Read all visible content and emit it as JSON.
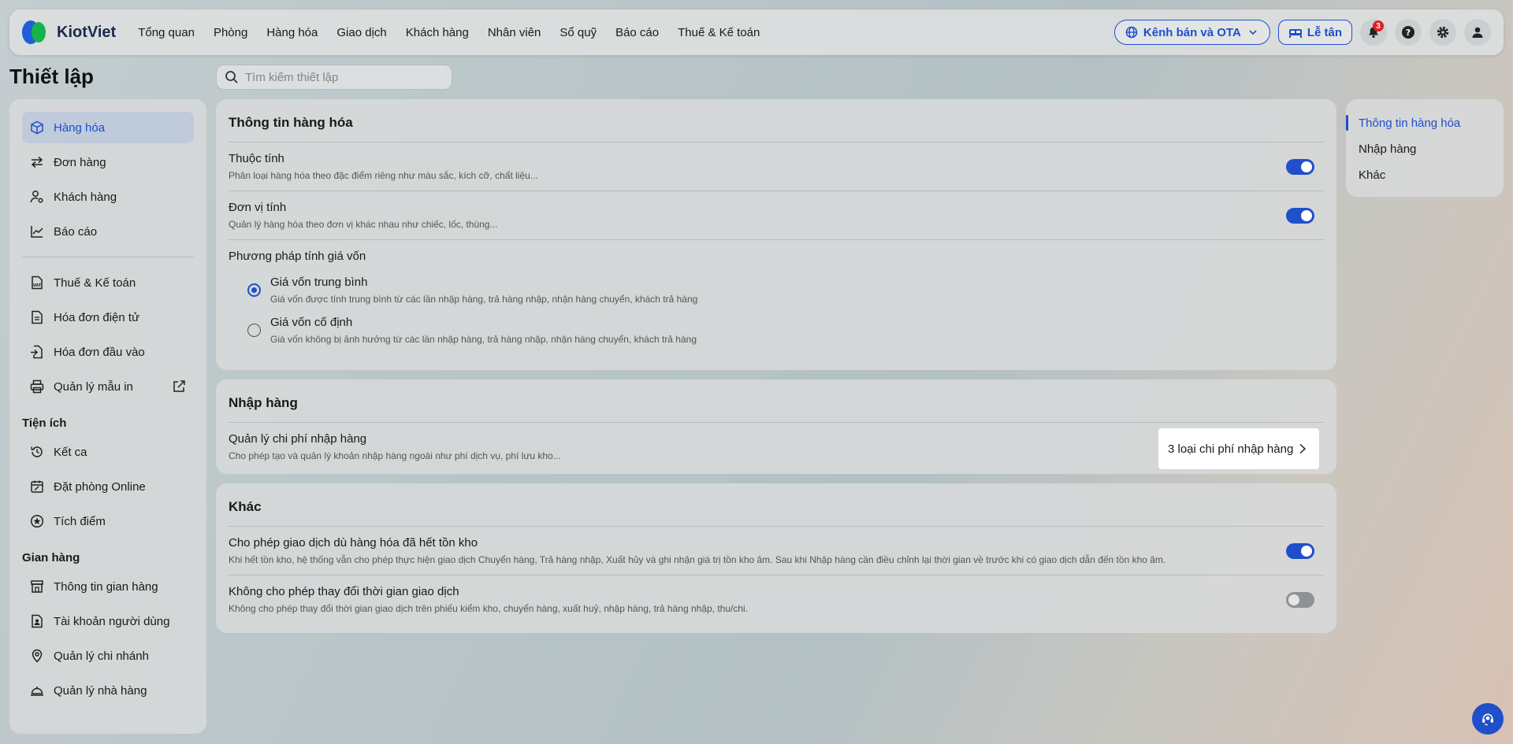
{
  "app": {
    "logo_text": "KiotViet"
  },
  "nav": {
    "items": [
      "Tổng quan",
      "Phòng",
      "Hàng hóa",
      "Giao dịch",
      "Khách hàng",
      "Nhân viên",
      "Sổ quỹ",
      "Báo cáo",
      "Thuế & Kế toán"
    ],
    "channel_label": "Kênh bán và OTA",
    "reception_label": "Lễ tân",
    "notification_count": "3"
  },
  "page": {
    "title": "Thiết lập"
  },
  "search": {
    "placeholder": "Tìm kiếm thiết lập"
  },
  "sidebar": {
    "items": [
      {
        "label": "Hàng hóa",
        "icon": "box-icon",
        "active": true
      },
      {
        "label": "Đơn hàng",
        "icon": "swap-icon"
      },
      {
        "label": "Khách hàng",
        "icon": "user-settings-icon"
      },
      {
        "label": "Báo cáo",
        "icon": "chart-icon"
      }
    ],
    "items2": [
      {
        "label": "Thuế & Kế toán",
        "icon": "vat-icon"
      },
      {
        "label": "Hóa đơn điện tử",
        "icon": "document-icon"
      },
      {
        "label": "Hóa đơn đầu vào",
        "icon": "import-document-icon"
      },
      {
        "label": "Quản lý mẫu in",
        "icon": "printer-icon"
      }
    ],
    "section_utilities": "Tiện ích",
    "utilities": [
      {
        "label": "Kết ca",
        "icon": "history-icon"
      },
      {
        "label": "Đặt phòng Online",
        "icon": "calendar-edit-icon"
      },
      {
        "label": "Tích điểm",
        "icon": "star-circle-icon"
      }
    ],
    "section_store": "Gian hàng",
    "store": [
      {
        "label": "Thông tin gian hàng",
        "icon": "store-icon"
      },
      {
        "label": "Tài khoản người dùng",
        "icon": "user-card-icon"
      },
      {
        "label": "Quản lý chi nhánh",
        "icon": "location-icon"
      },
      {
        "label": "Quản lý nhà hàng",
        "icon": "cloche-icon"
      }
    ]
  },
  "goods_panel": {
    "title": "Thông tin hàng hóa",
    "attributes": {
      "title": "Thuộc tính",
      "desc": "Phân loại hàng hóa theo đặc điểm riêng như màu sắc, kích cỡ, chất liệu...",
      "enabled": true
    },
    "units": {
      "title": "Đơn vị tính",
      "desc": "Quản lý hàng hóa theo đơn vị khác nhau như chiếc, lốc, thùng...",
      "enabled": true
    },
    "costing": {
      "title": "Phương pháp tính giá vốn",
      "options": [
        {
          "title": "Giá vốn trung bình",
          "desc": "Giá vốn được tính trung bình từ các lần nhập hàng, trả hàng nhập, nhận hàng chuyển, khách trả hàng",
          "selected": true
        },
        {
          "title": "Giá vốn cố định",
          "desc": "Giá vốn không bị ảnh hưởng từ các lần nhập hàng, trả hàng nhập, nhận hàng chuyển, khách trả hàng",
          "selected": false
        }
      ]
    }
  },
  "import_panel": {
    "title": "Nhập hàng",
    "cost": {
      "title": "Quản lý chi phí nhập hàng",
      "desc": "Cho phép tạo và quản lý khoản nhập hàng ngoài như phí dịch vụ, phí lưu kho...",
      "link_label": "3 loại chi phí nhập hàng"
    }
  },
  "other_panel": {
    "title": "Khác",
    "allow_oos": {
      "title": "Cho phép giao dịch dù hàng hóa đã hết tồn kho",
      "desc": "Khi hết tồn kho, hệ thống vẫn cho phép thực hiện giao dịch Chuyển hàng, Trả hàng nhập, Xuất hủy và ghi nhận giá trị tồn kho âm. Sau khi Nhập hàng cần điều chỉnh lại thời gian về trước khi có giao dịch dẫn đến tồn kho âm.",
      "enabled": true
    },
    "lock_time": {
      "title": "Không cho phép thay đổi thời gian giao dịch",
      "desc": "Không cho phép thay đổi thời gian giao dịch trên phiếu kiểm kho, chuyển hàng, xuất huỷ, nhập hàng, trả hàng nhập, thu/chi.",
      "enabled": false
    }
  },
  "toc": {
    "items": [
      "Thông tin hàng hóa",
      "Nhập hàng",
      "Khác"
    ]
  },
  "colors": {
    "accent": "#1f4fc9",
    "toggle_off": "#8d9295",
    "badge": "#e02020"
  }
}
